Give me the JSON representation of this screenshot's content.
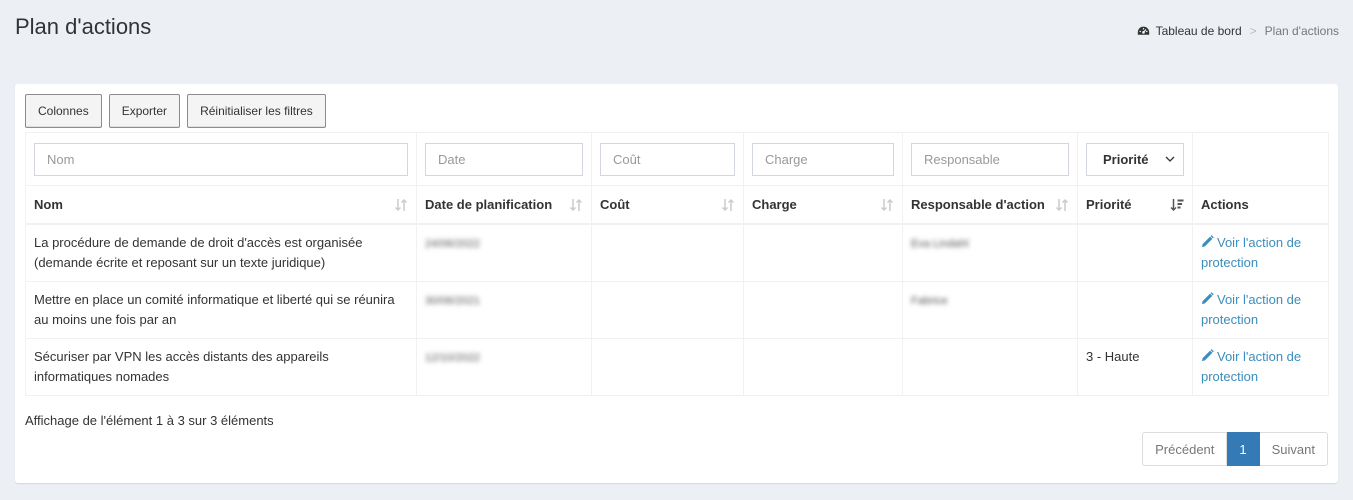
{
  "page": {
    "title": "Plan d'actions"
  },
  "breadcrumb": {
    "home_label": "Tableau de bord",
    "separator": ">",
    "current_label": "Plan d'actions"
  },
  "toolbar": {
    "columns_label": "Colonnes",
    "export_label": "Exporter",
    "reset_label": "Réinitialiser les filtres"
  },
  "filters": {
    "nom_placeholder": "Nom",
    "date_placeholder": "Date",
    "cout_placeholder": "Coût",
    "charge_placeholder": "Charge",
    "responsable_placeholder": "Responsable",
    "priorite_selected": "Priorité"
  },
  "table": {
    "headers": [
      "Nom",
      "Date de planification",
      "Coût",
      "Charge",
      "Responsable d'action",
      "Priorité",
      "Actions"
    ],
    "rows": [
      {
        "nom": "La procédure de demande de droit d'accès est organisée (demande écrite et reposant sur un texte juridique)",
        "date": "24/06/2022",
        "cout": "",
        "charge": "",
        "responsable": "Eva Lindahl",
        "priorite": "",
        "action": "Voir l'action de protection"
      },
      {
        "nom": "Mettre en place un comité informatique et liberté qui se réunira au moins une fois par an",
        "date": "30/06/2021",
        "cout": "",
        "charge": "",
        "responsable": "Fabrice",
        "priorite": "",
        "action": "Voir l'action de protection"
      },
      {
        "nom": "Sécuriser par VPN les accès distants des appareils informatiques nomades",
        "date": "12/10/2022",
        "cout": "",
        "charge": "",
        "responsable": "",
        "priorite": "3 - Haute",
        "action": "Voir l'action de protection"
      }
    ]
  },
  "footer": {
    "info": "Affichage de l'élément 1 à 3 sur 3 éléments",
    "prev_label": "Précédent",
    "current_page": "1",
    "next_label": "Suivant"
  },
  "colors": {
    "background": "#ecf0f5",
    "link": "#3c8dbc",
    "active_page": "#337ab7"
  },
  "icons": {
    "breadcrumb": "dashboard-icon",
    "sort": "sort-icon",
    "sort_active": "sort-amount-desc-icon",
    "action": "pencil-icon",
    "select": "chevron-down-icon"
  }
}
